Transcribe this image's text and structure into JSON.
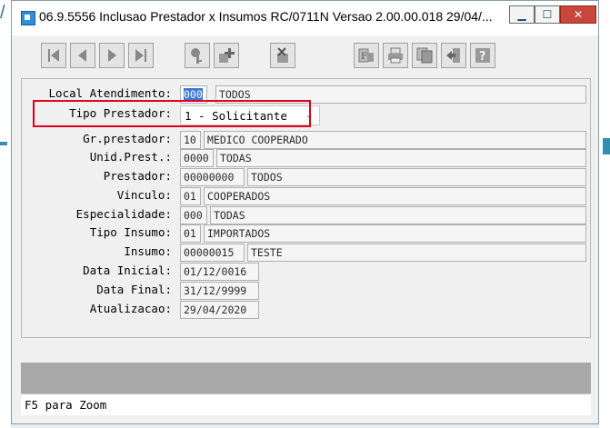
{
  "window": {
    "title": "06.9.5556 Inclusao  Prestador x Insumos RC/0711N Versao 2.00.00.018 29/04/...",
    "minimize": "▁",
    "maximize": "☐",
    "close": "✕"
  },
  "toolbar": {
    "buttons": [
      {
        "name": "first-record",
        "icon": "first-icon"
      },
      {
        "name": "previous-record",
        "icon": "prev-icon"
      },
      {
        "name": "next-record",
        "icon": "next-icon"
      },
      {
        "name": "last-record",
        "icon": "last-icon"
      },
      {
        "name": "search",
        "icon": "key-search-icon"
      },
      {
        "name": "add",
        "icon": "add-icon"
      },
      {
        "name": "delete",
        "icon": "delete-icon"
      },
      {
        "name": "filter",
        "icon": "filter-icon"
      },
      {
        "name": "print",
        "icon": "print-icon"
      },
      {
        "name": "copy",
        "icon": "copy-icon"
      },
      {
        "name": "exit",
        "icon": "exit-icon"
      },
      {
        "name": "help",
        "icon": "help-icon"
      }
    ]
  },
  "form": {
    "local_atendimento": {
      "label": "Local Atendimento:",
      "code": "000",
      "desc": "TODOS"
    },
    "tipo_prestador": {
      "label": "Tipo Prestador:",
      "value": "1 - Solicitante"
    },
    "gr_prestador": {
      "label": "Gr.prestador:",
      "code": "10",
      "desc": "MEDICO COOPERADO"
    },
    "unid_prest": {
      "label": "Unid.Prest.:",
      "code": "0000",
      "desc": "TODAS"
    },
    "prestador": {
      "label": "Prestador:",
      "code": "00000000",
      "desc": "TODOS"
    },
    "vinculo": {
      "label": "Vinculo:",
      "code": "01",
      "desc": "COOPERADOS"
    },
    "especialidade": {
      "label": "Especialidade:",
      "code": "000",
      "desc": "TODAS"
    },
    "tipo_insumo": {
      "label": "Tipo Insumo:",
      "code": "01",
      "desc": "IMPORTADOS"
    },
    "insumo": {
      "label": "Insumo:",
      "code": "00000015",
      "desc": "TESTE"
    },
    "data_inicial": {
      "label": "Data Inicial:",
      "value": "01/12/0016"
    },
    "data_final": {
      "label": "Data Final:",
      "value": "31/12/9999"
    },
    "atualizacao": {
      "label": "Atualizacao:",
      "value": "29/04/2020"
    }
  },
  "status": {
    "text": "F5 para Zoom"
  },
  "colors": {
    "highlight": "#e0001b",
    "selection": "#3b78d8"
  }
}
